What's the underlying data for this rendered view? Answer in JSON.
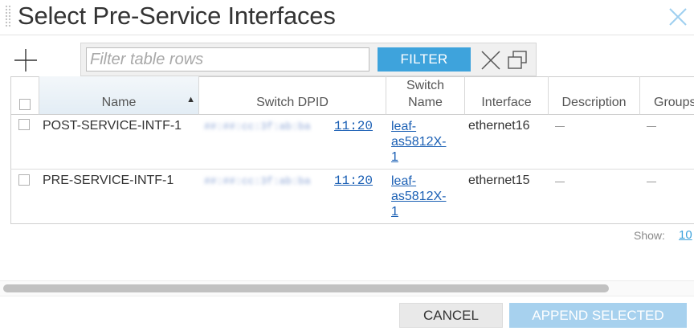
{
  "dialog": {
    "title": "Select Pre-Service Interfaces"
  },
  "toolbar": {
    "filter_placeholder": "Filter table rows",
    "filter_value": "",
    "filter_label": "FILTER"
  },
  "table": {
    "columns": [
      "Name",
      "Switch DPID",
      "Switch\nName",
      "Interface",
      "Description",
      "Groups"
    ],
    "sorted_column": "Name",
    "sort_direction": "ascending",
    "rows": [
      {
        "name": "POST-SERVICE-INTF-1",
        "dpid_visible": "11:20",
        "switch_name": "leaf-\nas5812X-\n1",
        "interface": "ethernet16",
        "description": "—",
        "groups": "—"
      },
      {
        "name": "PRE-SERVICE-INTF-1",
        "dpid_visible": "11:20",
        "switch_name": "leaf-\nas5812X-\n1",
        "interface": "ethernet15",
        "description": "—",
        "groups": "—"
      }
    ]
  },
  "pager": {
    "show_label": "Show:",
    "show_value": "10"
  },
  "footer": {
    "cancel_label": "CANCEL",
    "append_label": "APPEND SELECTED"
  },
  "colors": {
    "accent": "#3ea3dc",
    "accent_disabled": "#a7d1ee",
    "link": "#1a5fb4"
  },
  "icons": {
    "close": "close-icon",
    "add": "plus-icon",
    "clear": "clear-filter-icon",
    "popout": "popout-window-icon",
    "drag": "drag-handle-icon",
    "sort": "sort-ascending-icon"
  }
}
